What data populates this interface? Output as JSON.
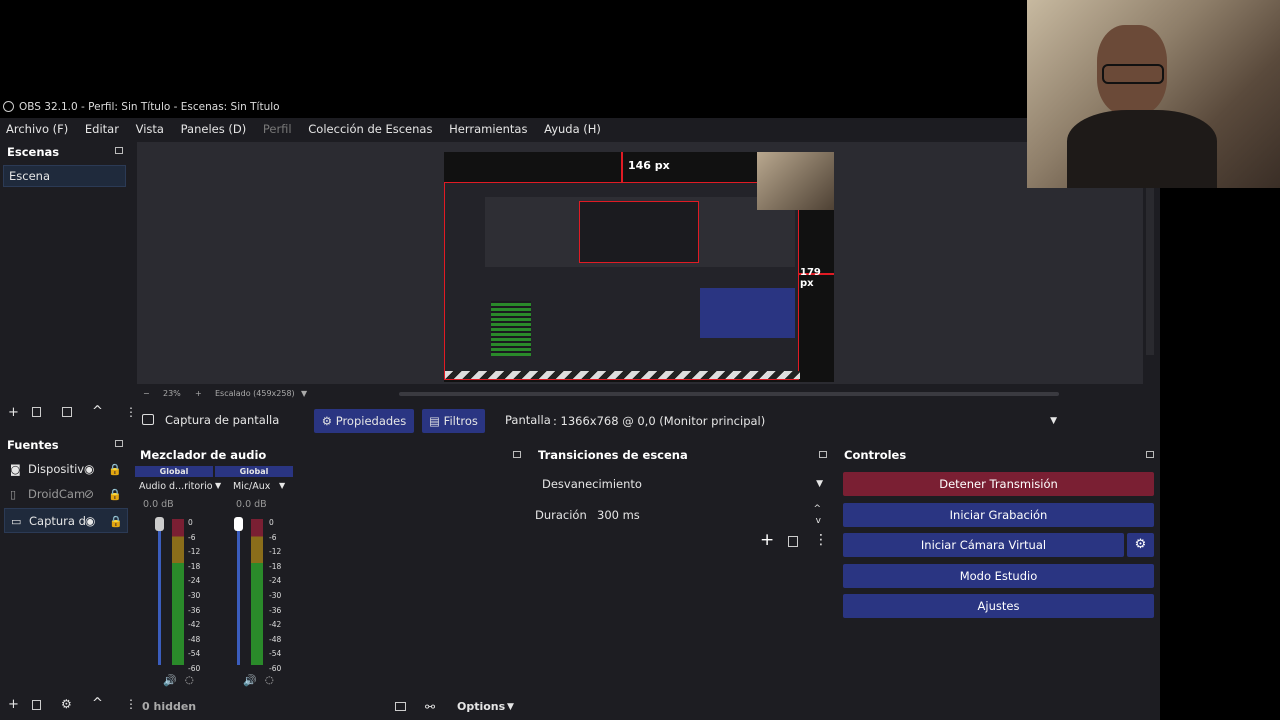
{
  "window": {
    "title": "OBS 32.1.0 - Perfil: Sin Título - Escenas: Sin Título"
  },
  "menu": [
    "Archivo (F)",
    "Editar",
    "Vista",
    "Paneles (D)",
    "Perfil",
    "Colección de Escenas",
    "Herramientas",
    "Ayuda (H)"
  ],
  "scenes": {
    "title": "Escenas",
    "items": [
      "Escena"
    ]
  },
  "sources": {
    "title": "Fuentes",
    "items": [
      "Dispositiv",
      "DroidCam",
      "Captura d"
    ]
  },
  "preview": {
    "zoom": "23%",
    "scale": "Escalado (459x258)",
    "top_px": "146 px",
    "right_px": "179 px"
  },
  "source_toolbar": {
    "source_name": "Captura de pantalla",
    "properties": "Propiedades",
    "filters": "Filtros",
    "display_label": "Pantalla",
    "display_value": ": 1366x768 @ 0,0 (Monitor principal)"
  },
  "mixer": {
    "title": "Mezclador de audio",
    "channels": [
      {
        "badge": "Global",
        "name": "Audio d...ritorio",
        "db": "0.0 dB"
      },
      {
        "badge": "Global",
        "name": "Mic/Aux",
        "db": "0.0 dB"
      }
    ],
    "scale": [
      "0",
      "-6",
      "-12",
      "-18",
      "-24",
      "-30",
      "-36",
      "-42",
      "-48",
      "-54",
      "-60"
    ],
    "hidden": "0 hidden",
    "options": "Options"
  },
  "transitions": {
    "title": "Transiciones de escena",
    "selected": "Desvanecimiento",
    "duration_label": "Duración",
    "duration_value": "300 ms"
  },
  "controls": {
    "title": "Controles",
    "stop_stream": "Detener Transmisión",
    "start_record": "Iniciar Grabación",
    "start_virtualcam": "Iniciar Cámara Virtual",
    "studio_mode": "Modo Estudio",
    "settings": "Ajustes"
  },
  "colors": {
    "accent_blue": "#2a3582",
    "stop_red": "#7a1f33",
    "selection_red": "#e01b24"
  }
}
